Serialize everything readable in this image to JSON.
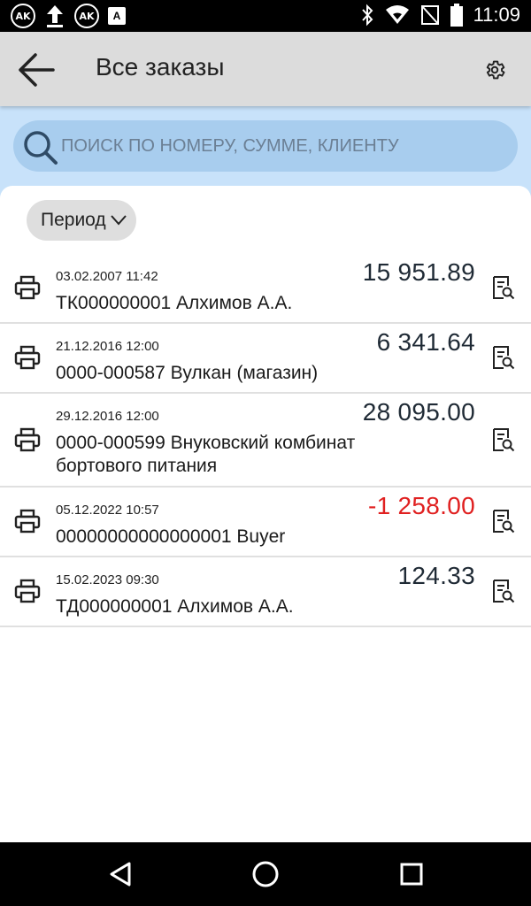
{
  "status_bar": {
    "left_icons": [
      "ak-circle-icon",
      "upload-icon",
      "ak-circle-icon",
      "text-a-icon"
    ],
    "left_labels": [
      "AK",
      "AK",
      "A"
    ],
    "right_icons": [
      "bluetooth-icon",
      "wifi-icon",
      "no-sim-icon",
      "battery-icon"
    ],
    "time": "11:09"
  },
  "app_bar": {
    "title": "Все заказы"
  },
  "search": {
    "placeholder": "ПОИСК ПО НОМЕРУ, СУММЕ, КЛИЕНТУ",
    "value": ""
  },
  "filter": {
    "period_label": "Период"
  },
  "orders": [
    {
      "date": "03.02.2007 11:42",
      "amount": "15 951.89",
      "description": "ТК000000001 Алхимов А.А.",
      "negative": false
    },
    {
      "date": "21.12.2016 12:00",
      "amount": "6 341.64",
      "description": "0000-000587 Вулкан (магазин)",
      "negative": false
    },
    {
      "date": "29.12.2016 12:00",
      "amount": "28 095.00",
      "description": "0000-000599 Внуковский комбинат бортового питания",
      "negative": false
    },
    {
      "date": "05.12.2022 10:57",
      "amount": "-1 258.00",
      "description": "00000000000000001 Buyer",
      "negative": true
    },
    {
      "date": "15.02.2023 09:30",
      "amount": "124.33",
      "description": "ТД000000001 Алхимов А.А.",
      "negative": false
    }
  ],
  "colors": {
    "app_bar": "#dcdcdc",
    "search_area": "#c8e2fa",
    "search_box": "#a8cdee",
    "negative_amount": "#e02020"
  }
}
